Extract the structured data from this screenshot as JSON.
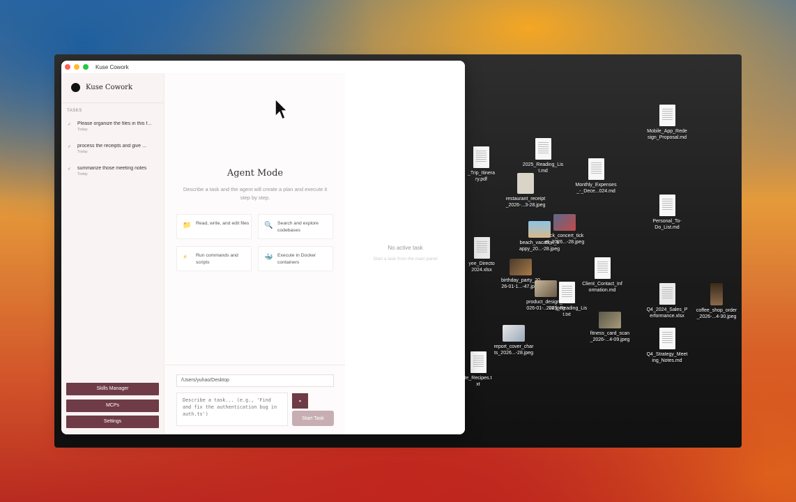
{
  "window": {
    "title": "Kuse Cowork"
  },
  "sidebar": {
    "brand": "Kuse Cowork",
    "tasks_heading": "TASKS",
    "tasks": [
      {
        "title": "Please organize the files in this f...",
        "date": "Today"
      },
      {
        "title": "process the receipts and give ...",
        "date": "Today"
      },
      {
        "title": "summarize those meeting notes",
        "date": "Today"
      }
    ],
    "buttons": {
      "skills": "Skills Manager",
      "mcps": "MCPs",
      "settings": "Settings"
    }
  },
  "main": {
    "title": "Agent Mode",
    "description": "Describe a task and the agent will create a plan and execute it step by step.",
    "features": [
      {
        "label": "Read, write, and edit files",
        "icon": "folder-icon"
      },
      {
        "label": "Search and explore codebases",
        "icon": "magnifier-icon"
      },
      {
        "label": "Run commands and scripts",
        "icon": "lightning-icon"
      },
      {
        "label": "Execute in Docker containers",
        "icon": "whale-icon"
      }
    ],
    "composer": {
      "path": "/Users/yuhao/Desktop",
      "placeholder": "Describe a task... (e.g., 'Find and fix the authentication bug in auth.ts')",
      "start_label": "Start Task"
    }
  },
  "right_panel": {
    "title": "No active task",
    "subtitle": "Start a task from the main panel"
  },
  "desktop_files": [
    {
      "label": "Mobile_App_Rede\nsign_Proposal.md",
      "kind": "doc"
    },
    {
      "label": "_Trip_Itinera\nry.pdf",
      "kind": "doc"
    },
    {
      "label": "2025_Reading_Lis\nt.md",
      "kind": "doc"
    },
    {
      "label": "Monthly_Expenses\n_-_Dece...024.md",
      "kind": "doc"
    },
    {
      "label": "restaurant_receipt\n_2026-...3-28.jpeg",
      "kind": "photo"
    },
    {
      "label": "Personal_To-\nDo_List.md",
      "kind": "doc"
    },
    {
      "label": "rock_concert_tick\net_2026...-28.jpeg",
      "kind": "photo"
    },
    {
      "label": "beach_vacation_h\nappy_20...-28.jpeg",
      "kind": "photo"
    },
    {
      "label": "No active task",
      "kind": "none"
    },
    {
      "label": "yee_Directo\n2024.xlsx",
      "kind": "sheet"
    },
    {
      "label": "birthday_party_20\n26-01-1...-47.jpeg",
      "kind": "photo"
    },
    {
      "label": "Client_Contact_Inf\normation.md",
      "kind": "doc"
    },
    {
      "label": "product_design_2\n026-01-...-28.jpeg",
      "kind": "photo"
    },
    {
      "label": "2025_Reading_Lis\nt.txt",
      "kind": "doc"
    },
    {
      "label": "Q4_2024_Sales_P\nerformance.xlsx",
      "kind": "sheet"
    },
    {
      "label": "coffee_shop_order\n_2026-...4-30.jpeg",
      "kind": "photo"
    },
    {
      "label": "fitness_card_scan\n_2026-...4-09.jpeg",
      "kind": "photo"
    },
    {
      "label": "report_cover_char\nts_2026...-28.jpeg",
      "kind": "photo"
    },
    {
      "label": "Q4_Strategy_Meet\ning_Notes.md",
      "kind": "doc"
    },
    {
      "label": "te_Recipes.t\nxt",
      "kind": "doc"
    }
  ],
  "colors": {
    "accent": "#6e3b47",
    "start_button": "#c7aeb3",
    "sidebar_bg": "#f9f3f3"
  }
}
